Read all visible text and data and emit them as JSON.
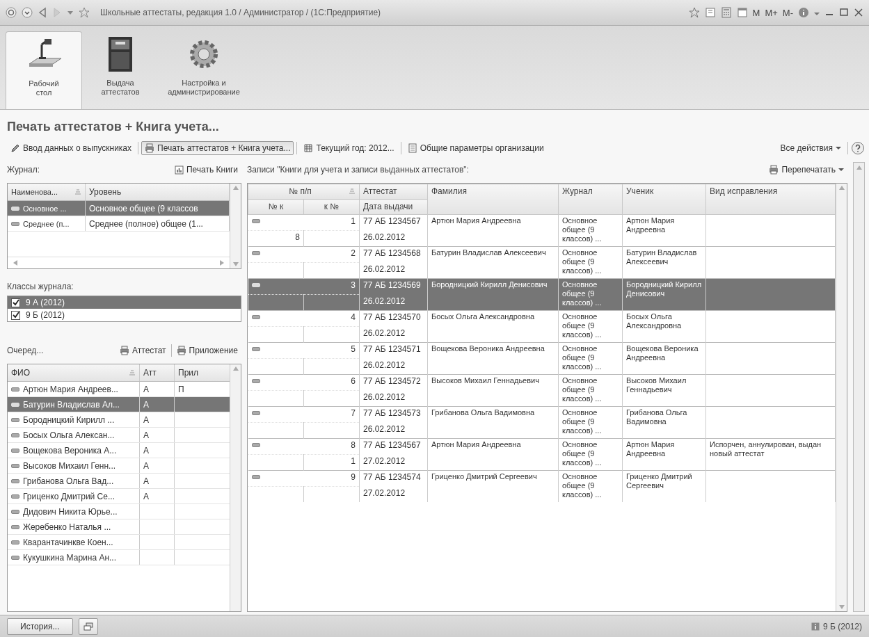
{
  "window": {
    "title": "Школьные аттестаты, редакция 1.0 / Администратор /  (1С:Предприятие)",
    "memory_buttons": [
      "M",
      "M+",
      "M-"
    ]
  },
  "sections": [
    {
      "label": "Рабочий стол",
      "kind": "desk",
      "selected": true
    },
    {
      "label": "Выдача аттестатов",
      "kind": "cabinet",
      "selected": false
    },
    {
      "label": "Настройка и администрирование",
      "kind": "gear",
      "selected": false
    }
  ],
  "form_title": "Печать аттестатов + Книга учета...",
  "toolbar": {
    "items": [
      {
        "label": "Ввод данных о выпускниках",
        "kind": "pencil",
        "selected": false
      },
      {
        "label": "Печать аттестатов + Книга учета...",
        "kind": "printer",
        "selected": true
      },
      {
        "label": "Текущий год: 2012...",
        "kind": "table",
        "selected": false
      },
      {
        "label": "Общие параметры организации",
        "kind": "page",
        "selected": false
      }
    ],
    "all_actions": "Все действия"
  },
  "journal": {
    "label": "Журнал:",
    "print_button": "Печать Книги",
    "columns": [
      "Наименова...",
      "Уровень"
    ],
    "rows": [
      {
        "name": "Основное ...",
        "level_name": "Основное общее (9 классов",
        "selected": true
      },
      {
        "name": "Среднее (п...",
        "level_name": "Среднее (полное) общее (1...",
        "selected": false
      }
    ]
  },
  "classes": {
    "label": "Классы журнала:",
    "items": [
      {
        "label": "9 А (2012)",
        "checked": true,
        "selected": true
      },
      {
        "label": "9 Б (2012)",
        "checked": true,
        "selected": false
      }
    ]
  },
  "queue": {
    "label": "Очеред...",
    "buttons": [
      "Аттестат",
      "Приложение"
    ],
    "columns": [
      "ФИО",
      "Атт",
      "Прил"
    ],
    "rows": [
      {
        "name": "Артюн Мария Андреев...",
        "att": "А",
        "pril": "П",
        "selected": false
      },
      {
        "name": "Батурин Владислав Ал...",
        "att": "А",
        "pril": "",
        "selected": true
      },
      {
        "name": "Бородницкий Кирилл ...",
        "att": "А",
        "pril": "",
        "selected": false
      },
      {
        "name": "Босых Ольга Алексан...",
        "att": "А",
        "pril": "",
        "selected": false
      },
      {
        "name": "Вощекова Вероника А...",
        "att": "А",
        "pril": "",
        "selected": false
      },
      {
        "name": "Высоков Михаил Генн...",
        "att": "А",
        "pril": "",
        "selected": false
      },
      {
        "name": "Грибанова Ольга Вад...",
        "att": "А",
        "pril": "",
        "selected": false
      },
      {
        "name": "Гриценко Дмитрий Се...",
        "att": "А",
        "pril": "",
        "selected": false
      },
      {
        "name": "Дидович Никита Юрье...",
        "att": "",
        "pril": "",
        "selected": false
      },
      {
        "name": "Жеребенко Наталья ...",
        "att": "",
        "pril": "",
        "selected": false
      },
      {
        "name": "Кварантачинкве Коен...",
        "att": "",
        "pril": "",
        "selected": false
      },
      {
        "name": "Кукушкина Марина Ан...",
        "att": "",
        "pril": "",
        "selected": false
      }
    ]
  },
  "records": {
    "label": "Записи \"Книги для учета и записи выданных аттестатов\":",
    "reprint_button": "Перепечатать",
    "columns": {
      "number": "№ п/п",
      "certificate": "Аттестат",
      "surname": "Фамилия",
      "journal": "Журнал",
      "student": "Ученик",
      "correction": "Вид исправления",
      "nk": "№ к",
      "kn": "к №",
      "date": "Дата выдачи"
    },
    "rows": [
      {
        "number": "1",
        "nk": "8",
        "kn": "",
        "certificate": "77 АБ 1234567",
        "date": "26.02.2012",
        "surname": "Артюн Мария Андреевна",
        "journal": "Основное общее (9 классов) ...",
        "student": "Артюн Мария Андреевна",
        "correction": "",
        "selected": false
      },
      {
        "number": "2",
        "nk": "",
        "kn": "",
        "certificate": "77 АБ 1234568",
        "date": "26.02.2012",
        "surname": "Батурин Владислав Алексеевич",
        "journal": "Основное общее (9 классов) ...",
        "student": "Батурин Владислав Алексеевич",
        "correction": "",
        "selected": false
      },
      {
        "number": "3",
        "nk": "",
        "kn": "",
        "certificate": "77 АБ 1234569",
        "date": "26.02.2012",
        "surname": "Бородницкий Кирилл Денисович",
        "journal": "Основное общее (9 классов) ...",
        "student": "Бородницкий Кирилл Денисович",
        "correction": "",
        "selected": true
      },
      {
        "number": "4",
        "nk": "",
        "kn": "",
        "certificate": "77 АБ 1234570",
        "date": "26.02.2012",
        "surname": "Босых Ольга Александровна",
        "journal": "Основное общее (9 классов) ...",
        "student": "Босых Ольга Александровна",
        "correction": "",
        "selected": false
      },
      {
        "number": "5",
        "nk": "",
        "kn": "",
        "certificate": "77 АБ 1234571",
        "date": "26.02.2012",
        "surname": "Вощекова Вероника Андреевна",
        "journal": "Основное общее (9 классов) ...",
        "student": "Вощекова Вероника Андреевна",
        "correction": "",
        "selected": false
      },
      {
        "number": "6",
        "nk": "",
        "kn": "",
        "certificate": "77 АБ 1234572",
        "date": "26.02.2012",
        "surname": "Высоков Михаил Геннадьевич",
        "journal": "Основное общее (9 классов) ...",
        "student": "Высоков Михаил Геннадьевич",
        "correction": "",
        "selected": false
      },
      {
        "number": "7",
        "nk": "",
        "kn": "",
        "certificate": "77 АБ 1234573",
        "date": "26.02.2012",
        "surname": "Грибанова Ольга Вадимовна",
        "journal": "Основное общее (9 классов) ...",
        "student": "Грибанова Ольга Вадимовна",
        "correction": "",
        "selected": false
      },
      {
        "number": "8",
        "nk": "",
        "kn": "1",
        "certificate": "77 АБ 1234567",
        "date": "27.02.2012",
        "surname": "Артюн Мария Андреевна",
        "journal": "Основное общее (9 классов) ...",
        "student": "Артюн Мария Андреевна",
        "correction": "Испорчен, аннулирован, выдан новый аттестат",
        "selected": false
      },
      {
        "number": "9",
        "nk": "",
        "kn": "",
        "certificate": "77 АБ 1234574",
        "date": "27.02.2012",
        "surname": "Гриценко Дмитрий Сергеевич",
        "journal": "Основное общее (9 классов) ...",
        "student": "Гриценко Дмитрий Сергеевич",
        "correction": "",
        "selected": false
      }
    ]
  },
  "footer": {
    "history_button": "История...",
    "status": "9 Б (2012)"
  }
}
